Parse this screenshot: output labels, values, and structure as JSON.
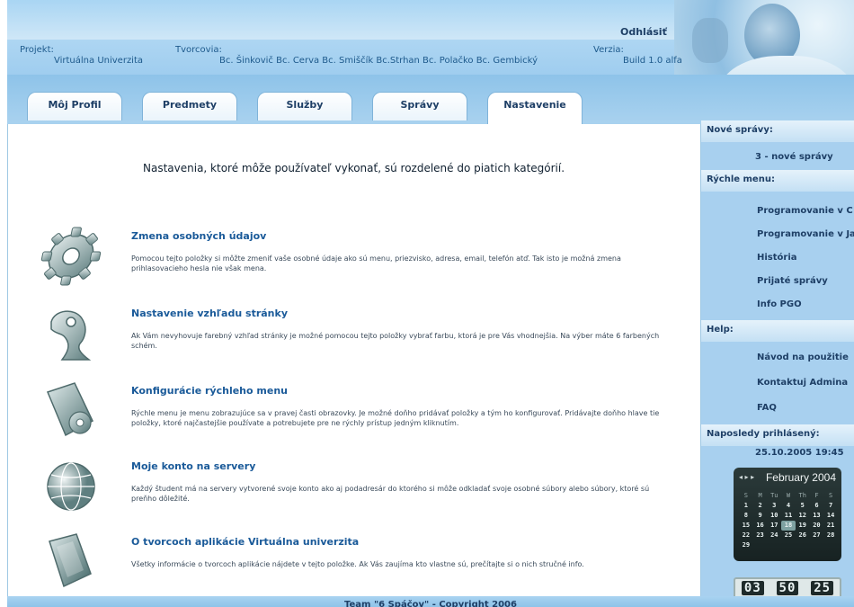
{
  "header": {
    "logout": "Odhlásiť",
    "project_label": "Projekt:",
    "project_value": "Virtuálna Univerzita",
    "authors_label": "Tvorcovia:",
    "authors_value": "Bc. Šinkovič  Bc. Cerva  Bc. Smiščík  Bc.Strhan  Bc. Polačko  Bc. Gembický",
    "version_label": "Verzia:",
    "version_value": "Build 1.0 alfa"
  },
  "tabs": [
    {
      "label": "Môj Profil"
    },
    {
      "label": "Predmety"
    },
    {
      "label": "Služby"
    },
    {
      "label": "Správy"
    },
    {
      "label": "Nastavenie"
    }
  ],
  "main": {
    "intro": "Nastavenia, ktoré môže používateľ vykonať, sú rozdelené do piatich kategórií.",
    "sections": [
      {
        "title": "Zmena osobných údajov",
        "desc": "Pomocou tejto položky si môžte zmeniť vaše osobné údaje ako sú menu, priezvisko, adresa, email, telefón atď. Tak isto je možná zmena prihlasovacieho hesla nie však mena.",
        "icon": "gear-icon"
      },
      {
        "title": "Nastavenie vzhľadu stránky",
        "desc": "Ak Vám nevyhovuje farebný vzhľad stránky je možné pomocou tejto položky vybrať farbu, ktorá je pre Vás vhodnejšia. Na výber máte 6 farbených schém.",
        "icon": "appearance-icon"
      },
      {
        "title": "Konfigurácie rýchleho menu",
        "desc": "Rýchle menu je menu zobrazujúce sa v pravej časti obrazovky. Je možné doňho pridávať položky a tým ho konfigurovať. Pridávajte doňho hlave tie položky, ktoré najčastejšie používate a potrebujete pre ne rýchly prístup jedným kliknutím.",
        "icon": "folder-gear-icon"
      },
      {
        "title": "Moje konto na servery",
        "desc": "Každý študent má na servery vytvorené svoje konto ako aj podadresár do ktorého si môže odkladať svoje osobné súbory alebo súbory, ktoré sú preňho dôležité.",
        "icon": "globe-icon"
      },
      {
        "title": "O tvorcoch aplikácie Virtuálna univerzita",
        "desc": "Všetky informácie o tvorcoch aplikácie nájdete v tejto položke. Ak Vás zaujíma kto vlastne sú, prečítajte si o nich stručné info.",
        "icon": "folder-icon"
      }
    ]
  },
  "sidebar": {
    "news_head": "Nové správy:",
    "news_value": "3 - nové správy",
    "quick_head": "Rýchle menu:",
    "quick_items": [
      "Programovanie v C",
      "Programovanie v Java",
      "História",
      "Prijaté správy",
      "Info PGO"
    ],
    "help_head": "Help:",
    "help_items": [
      "Návod na použitie",
      "Kontaktuj Admina",
      "FAQ"
    ],
    "last_login_head": "Naposledy prihlásený:",
    "last_login_value": "25.10.2005 19:45"
  },
  "calendar": {
    "arrows": "◂ ▸ ▸",
    "month": "February 2004",
    "weekdays": [
      "S",
      "M",
      "Tu",
      "W",
      "Th",
      "F",
      "S"
    ],
    "weeks": [
      [
        "1",
        "2",
        "3",
        "4",
        "5",
        "6",
        "7"
      ],
      [
        "8",
        "9",
        "10",
        "11",
        "12",
        "13",
        "14"
      ],
      [
        "15",
        "16",
        "17",
        "18",
        "19",
        "20",
        "21"
      ],
      [
        "22",
        "23",
        "24",
        "25",
        "26",
        "27",
        "28"
      ],
      [
        "29",
        "",
        "",
        "",
        "",
        "",
        ""
      ]
    ],
    "today": "18"
  },
  "clock": {
    "h": "03",
    "m": "50",
    "s": "25"
  },
  "footer": {
    "text": "Team \"6 Spáčov\" - Copyright 2006"
  }
}
